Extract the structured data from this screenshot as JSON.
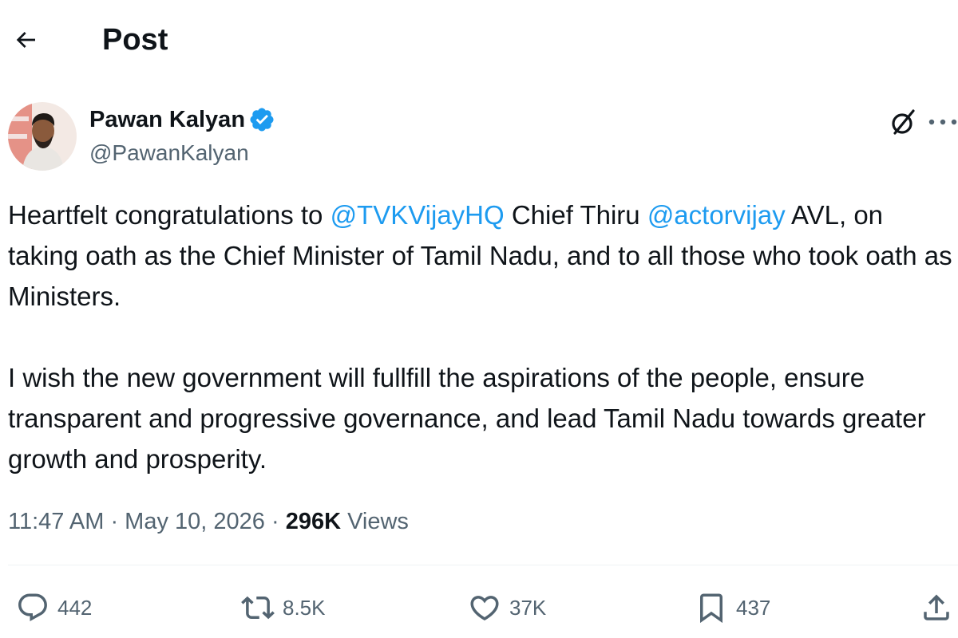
{
  "header": {
    "title": "Post"
  },
  "author": {
    "name": "Pawan Kalyan",
    "handle": "@PawanKalyan"
  },
  "tweet": {
    "p1_pre": "Heartfelt congratulations to ",
    "mention1": "@TVKVijayHQ",
    "p1_mid": " Chief Thiru ",
    "mention2": "@actorvijay",
    "p1_post": " AVL, on taking oath as the Chief Minister of Tamil Nadu, and to all those who took oath as Ministers.",
    "p2": "I wish the new government will fullfill the aspirations of the people, ensure transparent and progressive governance, and lead Tamil Nadu towards greater growth and prosperity."
  },
  "meta": {
    "time": "11:47 AM",
    "sep1": " · ",
    "date": "May 10, 2026",
    "sep2": " · ",
    "views_count": "296K",
    "views_label": " Views"
  },
  "actions": {
    "replies": "442",
    "reposts": "8.5K",
    "likes": "37K",
    "bookmarks": "437"
  },
  "icons": [
    "back-arrow-icon",
    "verified-badge-icon",
    "grok-icon",
    "more-icon",
    "reply-icon",
    "repost-icon",
    "like-icon",
    "bookmark-icon",
    "share-icon"
  ],
  "colors": {
    "text": "#0f1419",
    "secondary": "#536471",
    "accent": "#1d9bf0",
    "divider": "#eff3f4"
  }
}
